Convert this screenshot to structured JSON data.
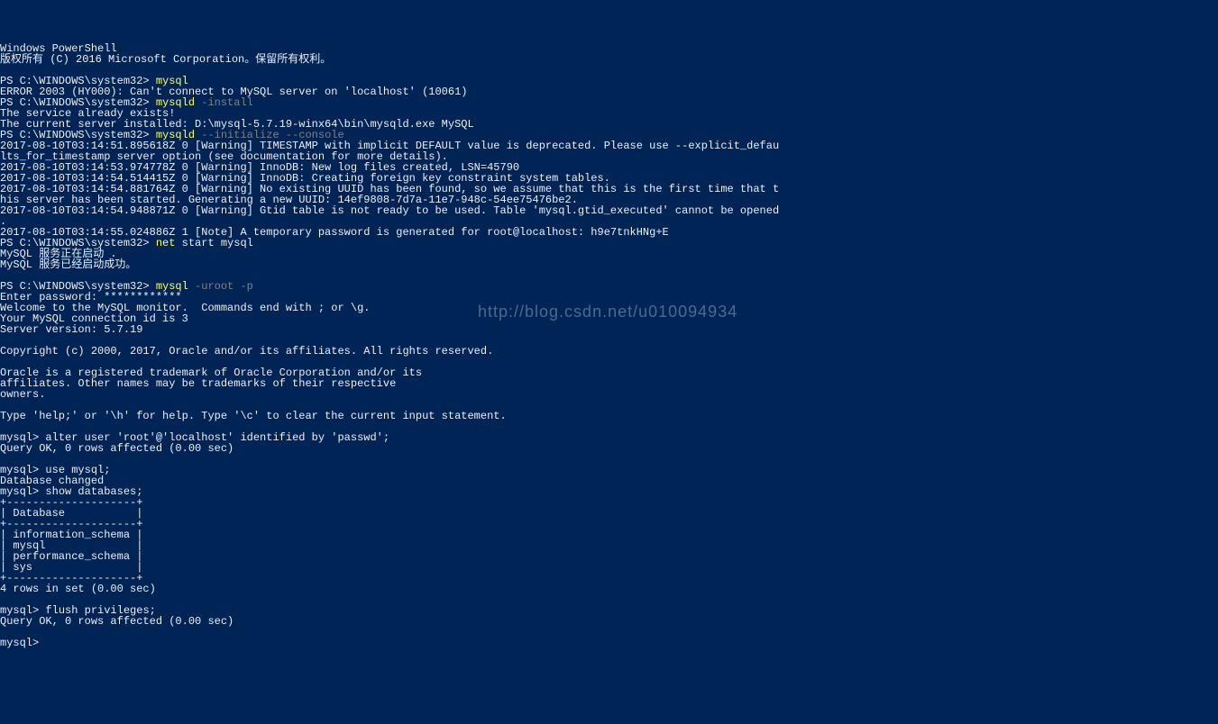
{
  "watermark": "http://blog.csdn.net/u010094934",
  "header": {
    "title": "Windows PowerShell",
    "copyright": "版权所有 (C) 2016 Microsoft Corporation。保留所有权利。"
  },
  "prompt": "PS C:\\WINDOWS\\system32> ",
  "cmds": {
    "c1": "mysql",
    "c2": "mysqld",
    "c2a": " -install",
    "c3": "mysqld",
    "c3a": " --initialize --console",
    "c4": "net",
    "c4a": " start mysql",
    "c5": "mysql",
    "c5a": " -uroot -p"
  },
  "out": {
    "err2003": "ERROR 2003 (HY000): Can't connect to MySQL server on 'localhost' (10061)",
    "svc1": "The service already exists!",
    "svc2": "The current server installed: D:\\mysql-5.7.19-winx64\\bin\\mysqld.exe MySQL",
    "w1": "2017-08-10T03:14:51.895618Z 0 [Warning] TIMESTAMP with implicit DEFAULT value is deprecated. Please use --explicit_defau",
    "w1b": "lts_for_timestamp server option (see documentation for more details).",
    "w2": "2017-08-10T03:14:53.974778Z 0 [Warning] InnoDB: New log files created, LSN=45790",
    "w3": "2017-08-10T03:14:54.514415Z 0 [Warning] InnoDB: Creating foreign key constraint system tables.",
    "w4": "2017-08-10T03:14:54.881764Z 0 [Warning] No existing UUID has been found, so we assume that this is the first time that t",
    "w4b": "his server has been started. Generating a new UUID: 14ef9808-7d7a-11e7-948c-54ee75476be2.",
    "w5": "2017-08-10T03:14:54.948871Z 0 [Warning] Gtid table is not ready to be used. Table 'mysql.gtid_executed' cannot be opened",
    "w5b": ".",
    "n1": "2017-08-10T03:14:55.024886Z 1 [Note] A temporary password is generated for root@localhost: h9e7tnkHNg+E",
    "net1": "MySQL 服务正在启动 .",
    "net2": "MySQL 服务已经启动成功。",
    "pw": "Enter password: ************",
    "welcome": "Welcome to the MySQL monitor.  Commands end with ; or \\g.",
    "connid": "Your MySQL connection id is 3",
    "ver": "Server version: 5.7.19",
    "copy": "Copyright (c) 2000, 2017, Oracle and/or its affiliates. All rights reserved.",
    "tm1": "Oracle is a registered trademark of Oracle Corporation and/or its",
    "tm2": "affiliates. Other names may be trademarks of their respective",
    "tm3": "owners.",
    "help": "Type 'help;' or '\\h' for help. Type '\\c' to clear the current input statement.",
    "mp": "mysql> ",
    "q1": "alter user 'root'@'localhost' identified by 'passwd';",
    "qok": "Query OK, 0 rows affected (0.00 sec)",
    "q2": "use mysql;",
    "dbch": "Database changed",
    "q3": "show databases;",
    "tbl_border": "+--------------------+",
    "tbl_hdr": "| Database           |",
    "tbl_r1": "| information_schema |",
    "tbl_r2": "| mysql              |",
    "tbl_r3": "| performance_schema |",
    "tbl_r4": "| sys                |",
    "rows": "4 rows in set (0.00 sec)",
    "q4": "flush privileges;"
  }
}
